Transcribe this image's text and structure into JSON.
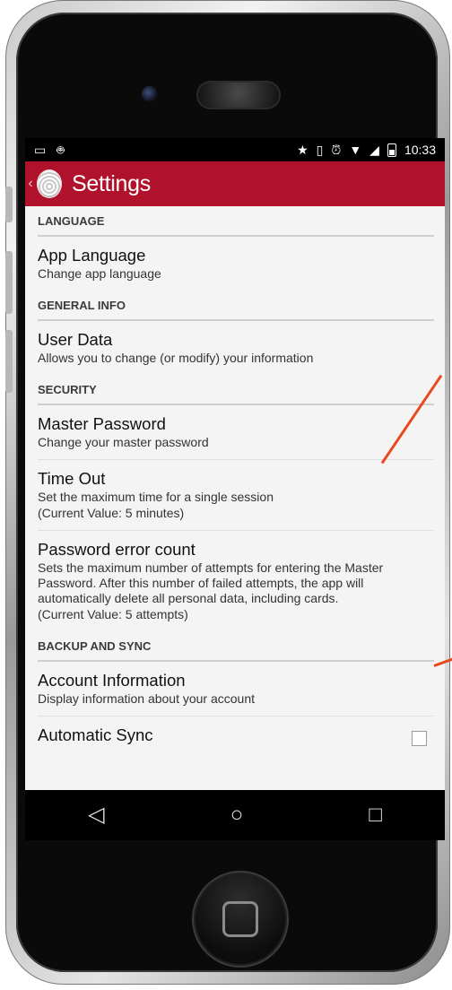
{
  "status_bar": {
    "time": "10:33",
    "left_icons": [
      "screenshot-icon",
      "android-icon"
    ],
    "right_icons": [
      "star-icon",
      "vibrate-icon",
      "alarm-icon",
      "wifi-icon",
      "signal-icon",
      "battery-icon"
    ]
  },
  "action_bar": {
    "title": "Settings"
  },
  "sections": [
    {
      "header": "LANGUAGE",
      "items": [
        {
          "title": "App Language",
          "summary": "Change app language"
        }
      ]
    },
    {
      "header": "GENERAL INFO",
      "items": [
        {
          "title": "User Data",
          "summary": "Allows you to change (or modify) your information"
        }
      ]
    },
    {
      "header": "SECURITY",
      "items": [
        {
          "title": "Master Password",
          "summary": "Change your master password"
        },
        {
          "title": "Time Out",
          "summary": "Set the maximum time for a single session",
          "summary2": "(Current Value: 5 minutes)"
        },
        {
          "title": "Password error count",
          "summary": "Sets the maximum number of attempts for entering the Master Password. After this number of failed attempts, the app will automatically delete all personal data, including cards.",
          "summary2": "(Current Value: 5 attempts)"
        }
      ]
    },
    {
      "header": "BACKUP AND SYNC",
      "items": [
        {
          "title": "Account Information",
          "summary": "Display information about your account"
        },
        {
          "title": "Automatic Sync",
          "checked": false
        }
      ]
    }
  ],
  "colors": {
    "action_bar": "#b0122b",
    "annotation": "#e84a1e",
    "background": "#f4f4f4"
  }
}
